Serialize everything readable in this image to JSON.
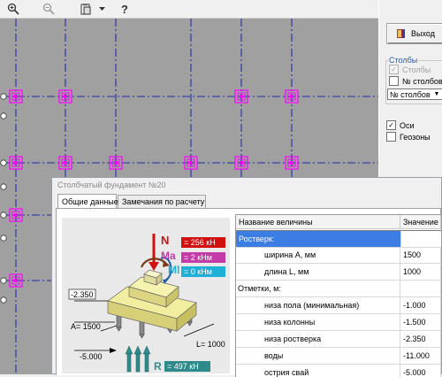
{
  "toolbar": {
    "icons": [
      "zoom-in-icon",
      "zoom-out-icon",
      "clipboard-icon",
      "dropdown-arrow-icon",
      "help-icon"
    ],
    "help_glyph": "?"
  },
  "right_panel": {
    "exit_button": "Выход",
    "columns_group": {
      "title": "Столбы",
      "columns_checkbox": {
        "label": "Столбы",
        "checked": true,
        "disabled": true
      },
      "numbers_checkbox": {
        "label": "№ столбов",
        "checked": false
      },
      "select_value": "№ столбов"
    },
    "axes_checkbox": {
      "label": "Оси",
      "checked": true
    },
    "geozones_checkbox": {
      "label": "Геозоны",
      "checked": false
    }
  },
  "dialog": {
    "title": "Столбчатый фундамент №20",
    "tabs": [
      "Общие данные",
      "Замечания по  расчету"
    ],
    "active_tab": 0,
    "diagram": {
      "N": {
        "symbol": "N",
        "value": "= 256 кН"
      },
      "Ma": {
        "symbol": "Ma",
        "value": "= 2 кНм"
      },
      "Ml": {
        "symbol": "Ml",
        "value": "= 0 кНм"
      },
      "R": {
        "symbol": "R",
        "value": "= 497 кН"
      },
      "dim_a": "A= 1500",
      "dim_l": "L= 1000",
      "level_top": "-2.350",
      "level_bottom": "-5.000"
    },
    "table": {
      "columns": [
        "Название величины",
        "Значение"
      ],
      "rows": [
        {
          "name": "Ростверк:",
          "value": "",
          "indent": false,
          "selected": true
        },
        {
          "name": "ширина A, мм",
          "value": "1500",
          "indent": true
        },
        {
          "name": "длина L, мм",
          "value": "1000",
          "indent": true
        },
        {
          "name": "Отметки, м:",
          "value": "",
          "indent": false
        },
        {
          "name": "низа пола (минимальная)",
          "value": "-1.000",
          "indent": true
        },
        {
          "name": "низа колонны",
          "value": "-1.500",
          "indent": true
        },
        {
          "name": "низа ростверка",
          "value": "-2.350",
          "indent": true
        },
        {
          "name": "воды",
          "value": "-11.000",
          "indent": true
        },
        {
          "name": "острия свай",
          "value": "-5.000",
          "indent": true
        }
      ]
    }
  },
  "colors": {
    "canvas_bg": "#a0a0a0",
    "grid_line": "#1f2fa8",
    "pile_magenta": "#ff00ff",
    "selection": "#3b7de2",
    "force_N": "#d21010",
    "force_Ma": "#c43aa8",
    "force_Ml": "#1fb0d8",
    "force_R": "#2f8a8a"
  }
}
